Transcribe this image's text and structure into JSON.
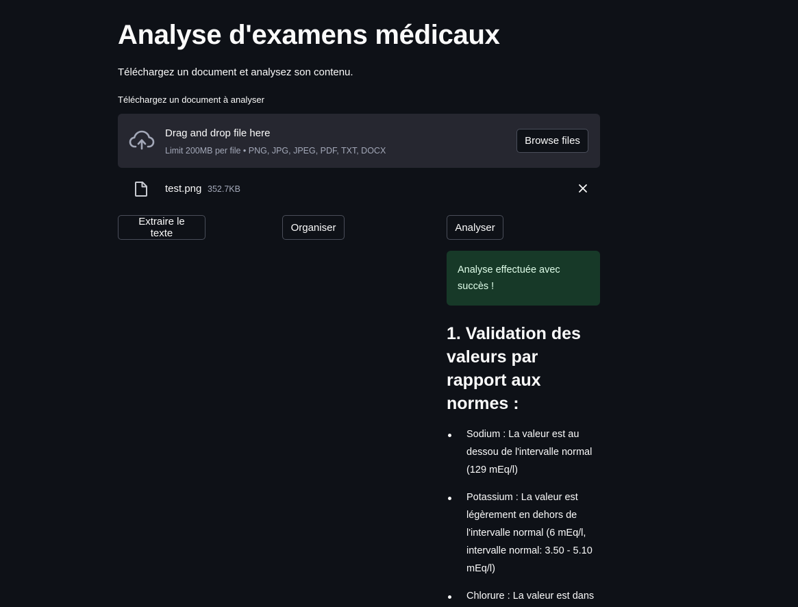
{
  "page": {
    "title": "Analyse d'examens médicaux",
    "subtitle": "Téléchargez un document et analysez son contenu."
  },
  "uploader": {
    "label": "Téléchargez un document à analyser",
    "drop_title": "Drag and drop file here",
    "limit_text": "Limit 200MB per file • PNG, JPG, JPEG, PDF, TXT, DOCX",
    "browse_label": "Browse files",
    "icon": "cloud-upload-icon"
  },
  "uploaded_file": {
    "name": "test.png",
    "size": "352.7KB",
    "icon": "file-icon",
    "remove_icon": "close-icon"
  },
  "actions": {
    "extract_label": "Extraire le texte",
    "organise_label": "Organiser",
    "analyse_label": "Analyser"
  },
  "result": {
    "success_message": "Analyse effectuée avec succès !",
    "heading": "1. Validation des valeurs par rapport aux normes :",
    "items": [
      "Sodium : La valeur est au dessou de l'intervalle normal (129 mEq/l)",
      "Potassium : La valeur est légèrement en dehors de l'intervalle normal (6 mEq/l, intervalle normal: 3.50 - 5.10 mEq/l)",
      "Chlorure : La valeur est dans"
    ]
  },
  "colors": {
    "background": "#0e1117",
    "dropzone": "#262730",
    "success_bg": "#173928",
    "success_text": "#dffde9",
    "text": "#fafafa",
    "muted": "#a3a8b8"
  }
}
